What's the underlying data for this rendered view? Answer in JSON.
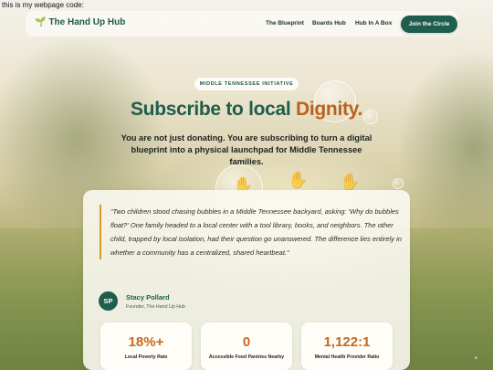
{
  "caption": "this is my webpage code:",
  "header": {
    "logo_icon": "sprout-icon",
    "logo_text": "The Hand Up Hub",
    "nav": [
      "The Blueprint",
      "Boards Hub",
      "Hub In A Box"
    ],
    "cta_label": "Join the Circle"
  },
  "hero": {
    "eyebrow": "MIDDLE TENNESSEE INITIATIVE",
    "headline_main": "Subscribe to local ",
    "headline_accent": "Dignity.",
    "subheadline": "You are not just donating. You are subscribing to turn a digital blueprint into a physical launchpad for Middle Tennessee families."
  },
  "testimonial": {
    "quote": "“Two children stood chasing bubbles in a Middle Tennessee backyard, asking: 'Why do bubbles float?' One family headed to a local center with a tool library, books, and neighbors. The other child, trapped by local isolation, had their question go unanswered. The difference lies entirely in whether a community has a centralized, shared heartbeat.”",
    "author_initials": "SP",
    "author_name": "Stacy Pollard",
    "author_role": "Founder, The Hand Up Hub"
  },
  "stats": [
    {
      "value": "18%+",
      "label": "Local Poverty Rate"
    },
    {
      "value": "0",
      "label": "Accessible Food Pantries Nearby"
    },
    {
      "value": "1,122:1",
      "label": "Mental Health Provider Ratio"
    }
  ],
  "colors": {
    "brand": "#1f5d4d",
    "accent": "#c4691f",
    "quote_border": "#d79a2c"
  }
}
